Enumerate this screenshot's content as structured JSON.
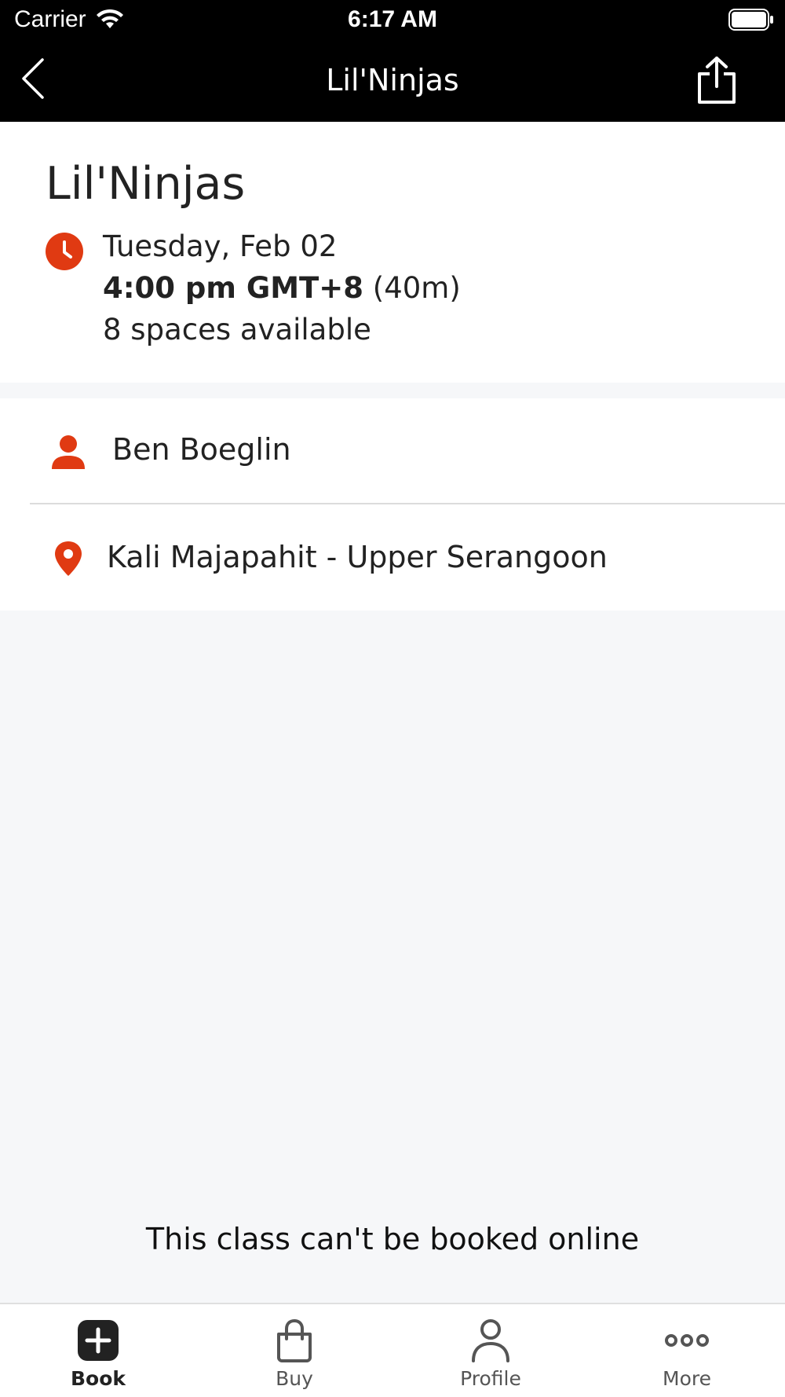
{
  "status_bar": {
    "carrier": "Carrier",
    "time": "6:17 AM"
  },
  "nav": {
    "title": "Lil'Ninjas",
    "back_icon": "chevron-left-icon",
    "share_icon": "share-icon"
  },
  "class": {
    "title": "Lil'Ninjas",
    "date": "Tuesday, Feb 02",
    "time": "4:00 pm GMT+8",
    "duration": "(40m)",
    "spaces": "8 spaces available"
  },
  "details": {
    "instructor": "Ben Boeglin",
    "location": "Kali Majapahit - Upper Serangoon"
  },
  "booking_note": "This class can't be booked online",
  "tabs": [
    {
      "label": "Book",
      "icon": "plus-square-icon",
      "active": true
    },
    {
      "label": "Buy",
      "icon": "shopping-bag-icon",
      "active": false
    },
    {
      "label": "Profile",
      "icon": "person-outline-icon",
      "active": false
    },
    {
      "label": "More",
      "icon": "more-dots-icon",
      "active": false
    }
  ],
  "colors": {
    "accent": "#e03a12",
    "nav_background": "#000000",
    "page_background": "#f6f7f9"
  }
}
